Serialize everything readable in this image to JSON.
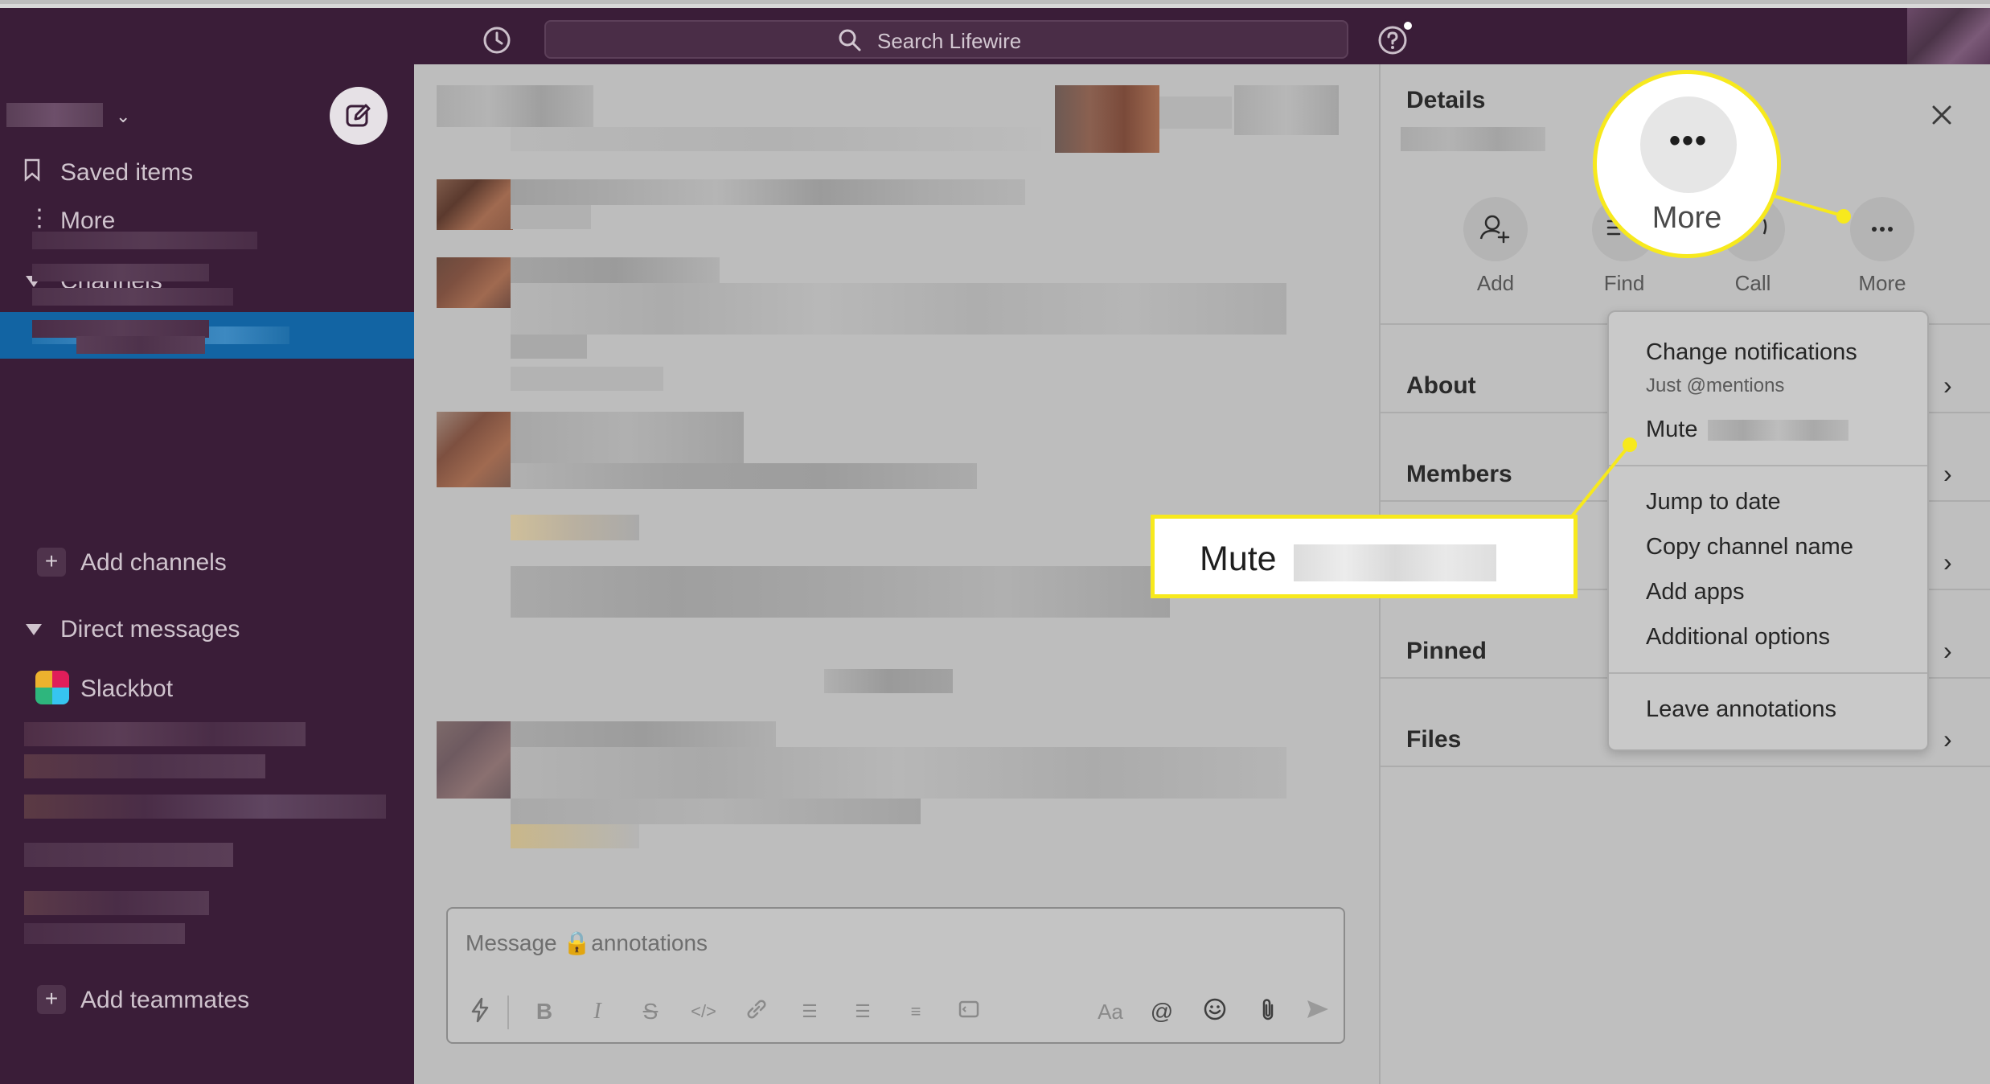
{
  "topbar": {
    "search_placeholder": "Search Lifewire",
    "history_icon": "clock-icon",
    "help_icon": "help-icon"
  },
  "sidebar": {
    "nav_items": [
      {
        "label": "Saved items",
        "icon": "bookmark-icon"
      },
      {
        "label": "More",
        "icon": "more-vertical-icon"
      }
    ],
    "channels_label": "Channels",
    "add_channels_label": "Add channels",
    "direct_messages_label": "Direct messages",
    "slackbot_label": "Slackbot",
    "add_teammates_label": "Add teammates"
  },
  "composer": {
    "placeholder": "Message 🔒annotations",
    "format_label": "Aa"
  },
  "details": {
    "title": "Details",
    "actions": [
      {
        "label": "Add",
        "icon": "add-person-icon"
      },
      {
        "label": "Find",
        "icon": "find-icon"
      },
      {
        "label": "Call",
        "icon": "call-icon"
      },
      {
        "label": "More",
        "icon": "more-horizontal-icon"
      }
    ],
    "rows": [
      {
        "label": "About"
      },
      {
        "label": "Members"
      },
      {
        "label": "Pinned"
      },
      {
        "label": "Files"
      }
    ]
  },
  "menu": {
    "change_notifications": "Change notifications",
    "notifications_sub": "Just @mentions",
    "mute": "Mute",
    "jump_to_date": "Jump to date",
    "copy_channel_name": "Copy channel name",
    "add_apps": "Add apps",
    "additional_options": "Additional options",
    "leave": "Leave annotations"
  },
  "callouts": {
    "more_label": "More",
    "mute_label": "Mute"
  },
  "colors": {
    "sidebar_bg": "#3a1d38",
    "active_channel": "#1264a3",
    "callout_border": "#f7e91d"
  }
}
